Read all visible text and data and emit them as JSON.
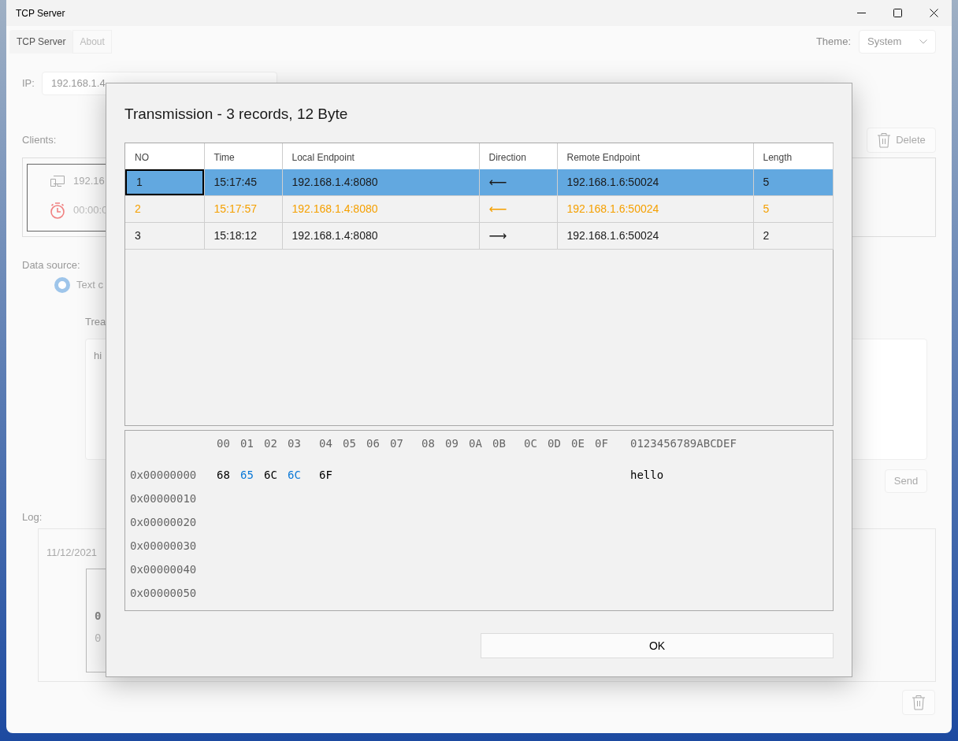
{
  "window": {
    "title": "TCP Server"
  },
  "main": {
    "tabs": [
      {
        "label": "TCP Server",
        "selected": true
      },
      {
        "label": "About",
        "selected": false
      }
    ],
    "theme": {
      "label": "Theme:",
      "value": "System"
    },
    "ip": {
      "label": "IP:",
      "value": "192.168.1.4"
    },
    "clients": {
      "label": "Clients:",
      "delete_button": "Delete",
      "items": [
        {
          "address": "192.16",
          "duration": "00:00:0"
        }
      ]
    },
    "data_source": {
      "label": "Data source:",
      "options": [
        {
          "label": "Text c",
          "checked": true
        }
      ]
    },
    "payload": {
      "label": "Trea",
      "value": "hi",
      "send_button": "Send"
    },
    "log": {
      "label": "Log:",
      "entries": [
        {
          "timestamp": "11/12/2021",
          "lines": [
            {
              "text": "0",
              "bold": true
            },
            {
              "text": "0",
              "bold": false
            }
          ]
        }
      ]
    }
  },
  "dialog": {
    "title": "Transmission - 3 records, 12 Byte",
    "table": {
      "columns": [
        "NO",
        "Time",
        "Local Endpoint",
        "Direction",
        "Remote Endpoint",
        "Length"
      ],
      "rows": [
        {
          "no": "1",
          "time": "15:17:45",
          "local": "192.168.1.4:8080",
          "direction": "⟵",
          "remote": "192.168.1.6:50024",
          "length": "5",
          "selected": true,
          "focused": true,
          "highlighted": false
        },
        {
          "no": "2",
          "time": "15:17:57",
          "local": "192.168.1.4:8080",
          "direction": "⟵",
          "remote": "192.168.1.6:50024",
          "length": "5",
          "selected": false,
          "focused": false,
          "highlighted": true
        },
        {
          "no": "3",
          "time": "15:18:12",
          "local": "192.168.1.4:8080",
          "direction": "⟶",
          "remote": "192.168.1.6:50024",
          "length": "2",
          "selected": false,
          "focused": false,
          "highlighted": false
        }
      ]
    },
    "hex": {
      "columns": [
        "00",
        "01",
        "02",
        "03",
        "04",
        "05",
        "06",
        "07",
        "08",
        "09",
        "0A",
        "0B",
        "0C",
        "0D",
        "0E",
        "0F"
      ],
      "ascii_header": "0123456789ABCDEF",
      "rows": [
        {
          "offset": "0x00000000",
          "bytes": [
            {
              "text": "68",
              "highlighted": false
            },
            {
              "text": "65",
              "highlighted": true
            },
            {
              "text": "6C",
              "highlighted": false
            },
            {
              "text": "6C",
              "highlighted": true
            },
            {
              "text": "6F",
              "highlighted": false
            }
          ],
          "ascii": "hello"
        },
        {
          "offset": "0x00000010"
        },
        {
          "offset": "0x00000020"
        },
        {
          "offset": "0x00000030"
        },
        {
          "offset": "0x00000040"
        },
        {
          "offset": "0x00000050"
        }
      ]
    },
    "ok_button": "OK"
  }
}
